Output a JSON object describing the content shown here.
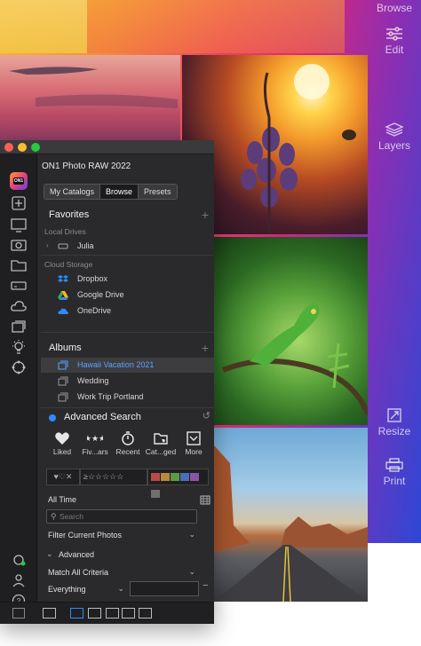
{
  "app": {
    "title": "ON1 Photo RAW 2022"
  },
  "right_tools": [
    {
      "label": "Browse",
      "icon": "browse-icon"
    },
    {
      "label": "Edit",
      "icon": "sliders-icon"
    },
    {
      "label": "Layers",
      "icon": "layers-icon"
    },
    {
      "label": "Resize",
      "icon": "resize-icon"
    },
    {
      "label": "Print",
      "icon": "print-icon"
    }
  ],
  "tabs": [
    {
      "label": "My Catalogs",
      "active": false
    },
    {
      "label": "Browse",
      "active": true
    },
    {
      "label": "Presets",
      "active": false
    }
  ],
  "favorites": {
    "title": "Favorites",
    "local_drives_label": "Local Drives",
    "local_drives": [
      {
        "label": "Julia",
        "icon": "drive-icon"
      }
    ],
    "cloud_storage_label": "Cloud Storage",
    "cloud": [
      {
        "label": "Dropbox",
        "icon": "dropbox-icon",
        "color": "#2d8cff"
      },
      {
        "label": "Google Drive",
        "icon": "google-drive-icon",
        "color": "#34a853"
      },
      {
        "label": "OneDrive",
        "icon": "onedrive-icon",
        "color": "#2d8cff"
      }
    ]
  },
  "albums": {
    "title": "Albums",
    "items": [
      {
        "label": "Hawaii Vacation 2021",
        "selected": true
      },
      {
        "label": "Wedding",
        "selected": false
      },
      {
        "label": "Work Trip Portland",
        "selected": false
      }
    ]
  },
  "advanced_search": {
    "title": "Advanced Search",
    "quick_buttons": [
      {
        "label": "Liked",
        "icon": "heart-icon"
      },
      {
        "label": "Fiv...ars",
        "icon": "stars-icon"
      },
      {
        "label": "Recent",
        "icon": "stopwatch-icon"
      },
      {
        "label": "Cat...ged",
        "icon": "tag-folder-icon"
      },
      {
        "label": "More",
        "icon": "more-icon"
      }
    ],
    "rating_symbol": "≥",
    "stars": "☆☆☆☆☆",
    "hearts": "♥♡✕",
    "color_swatches": [
      "#b94a4a",
      "#b98a3a",
      "#5c9a46",
      "#4a6fb9",
      "#8a55a8",
      "#6f6f6f"
    ],
    "time_filter": "All Time",
    "search_placeholder": "Search",
    "filter_label": "Filter Current Photos",
    "advanced_toggle": "Advanced",
    "match_label": "Match All Criteria",
    "field_label": "Everything",
    "field_value": ""
  },
  "colors": {
    "accent": "#2d8cff",
    "panel_bg": "#2a2a2c",
    "sidebar_bg": "#1f1f21"
  }
}
